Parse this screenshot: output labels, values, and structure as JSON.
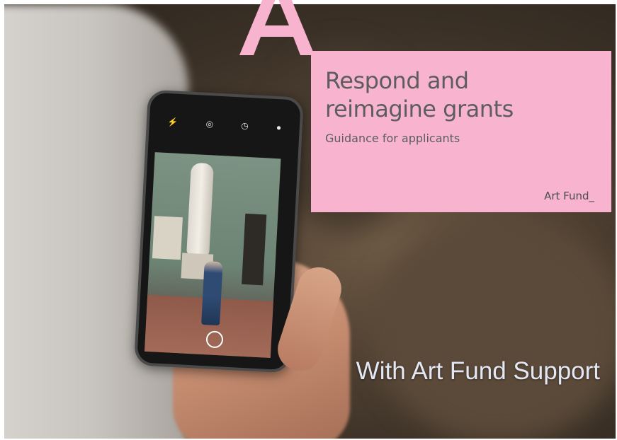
{
  "logo": {
    "letter": "A",
    "color": "#f8b4cf"
  },
  "card": {
    "title_line1": "Respond and",
    "title_line2": "reimagine grants",
    "subtitle": "Guidance for applicants",
    "brand": "Art Fund_",
    "background": "#f8b4cf",
    "text_color": "#5d5d5d"
  },
  "caption": {
    "text": "With Art Fund Support"
  },
  "phone": {
    "icons": [
      "flash-icon",
      "live-photo-icon",
      "timer-icon",
      "filter-icon"
    ],
    "glyphs": [
      "⚡",
      "◎",
      "◷",
      "●"
    ]
  }
}
